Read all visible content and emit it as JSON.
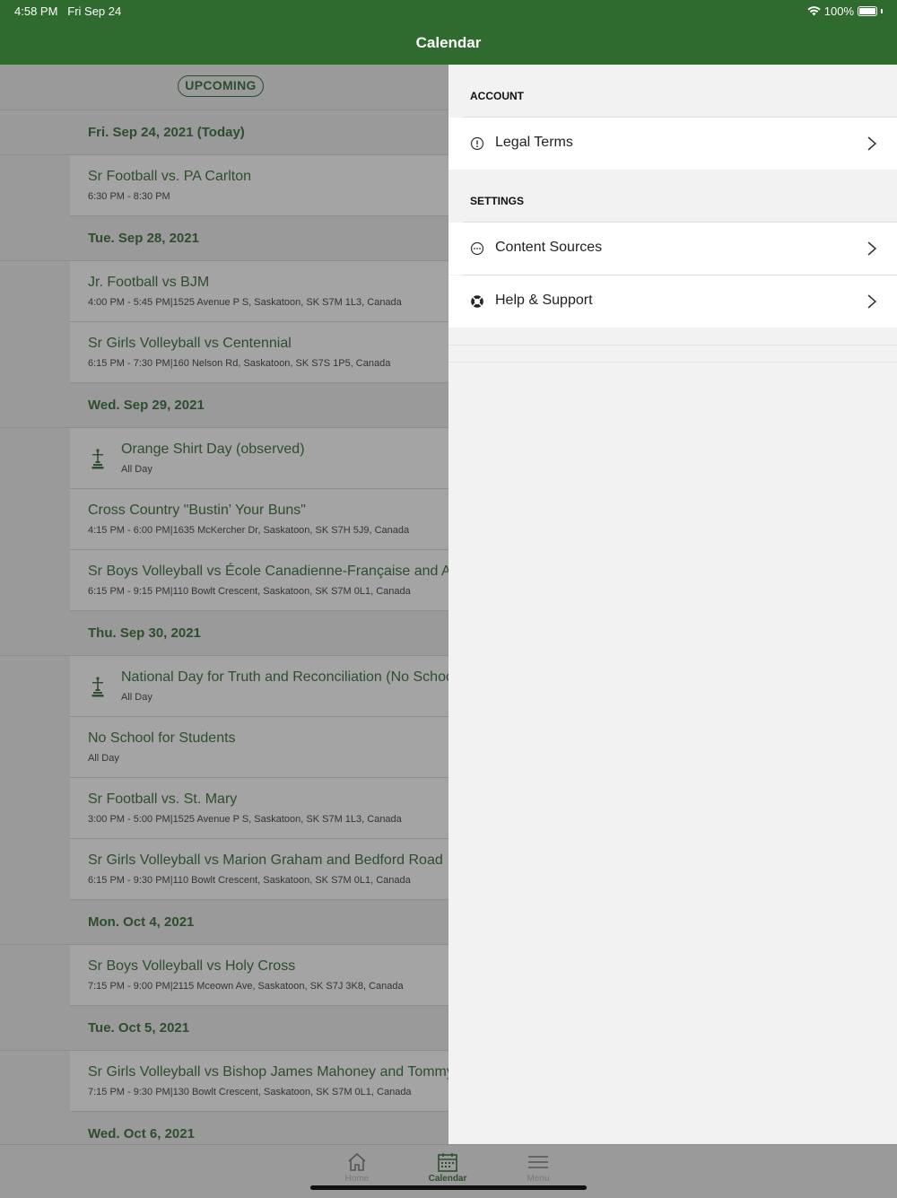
{
  "status_bar": {
    "time": "4:58 PM",
    "date": "Fri Sep 24",
    "battery": "100%"
  },
  "nav": {
    "title": "Calendar"
  },
  "filter": {
    "label": "UPCOMING"
  },
  "groups": [
    {
      "date": "Fri. Sep 24, 2021 (Today)",
      "events": [
        {
          "title": "Sr Football vs. PA Carlton",
          "sub": "6:30 PM - 8:30 PM",
          "icon": ""
        }
      ]
    },
    {
      "date": "Tue. Sep 28, 2021",
      "events": [
        {
          "title": "Jr. Football vs BJM",
          "sub": "4:00 PM - 5:45 PM|1525 Avenue P S, Saskatoon, SK S7M 1L3, Canada",
          "icon": ""
        },
        {
          "title": "Sr Girls Volleyball vs Centennial",
          "sub": "6:15 PM - 7:30 PM|160 Nelson Rd, Saskatoon, SK S7S 1P5, Canada",
          "icon": ""
        }
      ]
    },
    {
      "date": "Wed. Sep 29, 2021",
      "events": [
        {
          "title": "Orange Shirt Day (observed)",
          "sub": "All Day",
          "icon": "statue-icon"
        },
        {
          "title": "Cross Country \"Bustin' Your Buns\"",
          "sub": "4:15 PM - 6:00 PM|1635 McKercher Dr, Saskatoon, SK S7H 5J9, Canada",
          "icon": ""
        },
        {
          "title": "Sr Boys Volleyball vs École Canadienne-Française and Aden",
          "sub": "6:15 PM - 9:15 PM|110 Bowlt Crescent, Saskatoon, SK S7M 0L1, Canada",
          "icon": ""
        }
      ]
    },
    {
      "date": "Thu. Sep 30, 2021",
      "events": [
        {
          "title": "National Day for Truth and Reconciliation (No School)",
          "sub": "All Day",
          "icon": "statue-icon"
        },
        {
          "title": "No School for Students",
          "sub": "All Day",
          "icon": ""
        },
        {
          "title": "Sr Football vs. St. Mary",
          "sub": "3:00 PM - 5:00 PM|1525 Avenue P S, Saskatoon, SK S7M 1L3, Canada",
          "icon": ""
        },
        {
          "title": "Sr Girls Volleyball vs Marion Graham and Bedford Road",
          "sub": "6:15 PM - 9:30 PM|110 Bowlt Crescent, Saskatoon, SK S7M 0L1, Canada",
          "icon": ""
        }
      ]
    },
    {
      "date": "Mon. Oct 4, 2021",
      "events": [
        {
          "title": "Sr Boys Volleyball vs Holy Cross",
          "sub": "7:15 PM - 9:00 PM|2115 Mceown Ave, Saskatoon, SK S7J 3K8, Canada",
          "icon": ""
        }
      ]
    },
    {
      "date": "Tue. Oct 5, 2021",
      "events": [
        {
          "title": "Sr Girls Volleyball vs Bishop James Mahoney and Tommy D",
          "sub": "7:15 PM - 9:30 PM|130 Bowlt Crescent, Saskatoon, SK S7M 0L1, Canada",
          "icon": ""
        }
      ]
    },
    {
      "date": "Wed. Oct 6, 2021",
      "events": []
    }
  ],
  "drawer": {
    "account_label": "ACCOUNT",
    "settings_label": "SETTINGS",
    "legal": {
      "label": "Legal Terms",
      "icon": "info-icon"
    },
    "content_sources": {
      "label": "Content Sources",
      "icon": "ellipsis-circle-icon"
    },
    "help": {
      "label": "Help & Support",
      "icon": "lifebuoy-icon"
    }
  },
  "tabs": [
    {
      "label": "Home",
      "icon": "home-icon",
      "active": false
    },
    {
      "label": "Calendar",
      "icon": "calendar-icon",
      "active": true
    },
    {
      "label": "Menu",
      "icon": "menu-icon",
      "active": false
    }
  ],
  "colors": {
    "brand": "#2f6a2f",
    "text_green": "#2e4d2e"
  }
}
